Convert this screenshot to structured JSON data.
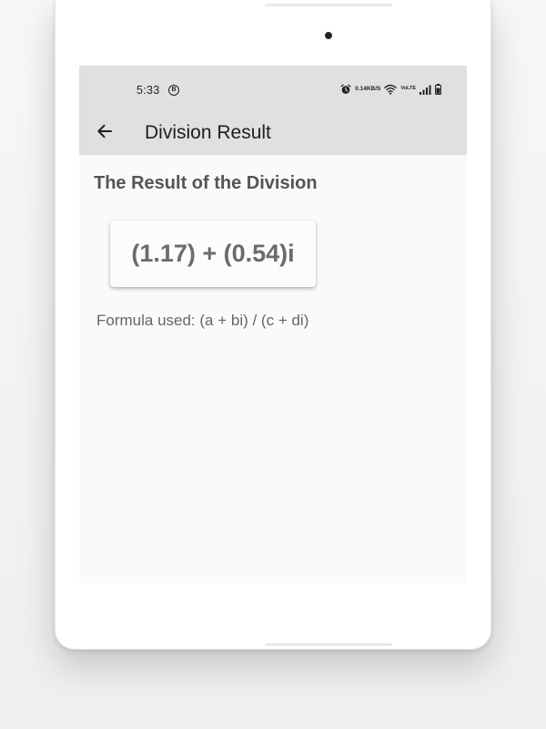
{
  "status_bar": {
    "time": "5:33",
    "b_icon_label": "B",
    "net_speed_value": "0.14",
    "net_speed_unit": "KB/S",
    "vo_label": "Vo",
    "lte_label": "LTE",
    "icons": [
      "alarm-icon",
      "wifi-icon",
      "volte-icon",
      "signal-icon",
      "battery-icon"
    ]
  },
  "app_bar": {
    "title": "Division Result",
    "back_icon": "arrow-left-icon"
  },
  "content": {
    "heading": "The Result of the Division",
    "result": "(1.17) + (0.54)i",
    "formula": "Formula used: (a + bi) / (c + di)"
  },
  "colors": {
    "app_bar_bg": "#e0e0e0",
    "screen_bg": "#fafafa",
    "heading_text": "#555555",
    "result_text": "#6b6b6b",
    "formula_text": "#666666"
  }
}
